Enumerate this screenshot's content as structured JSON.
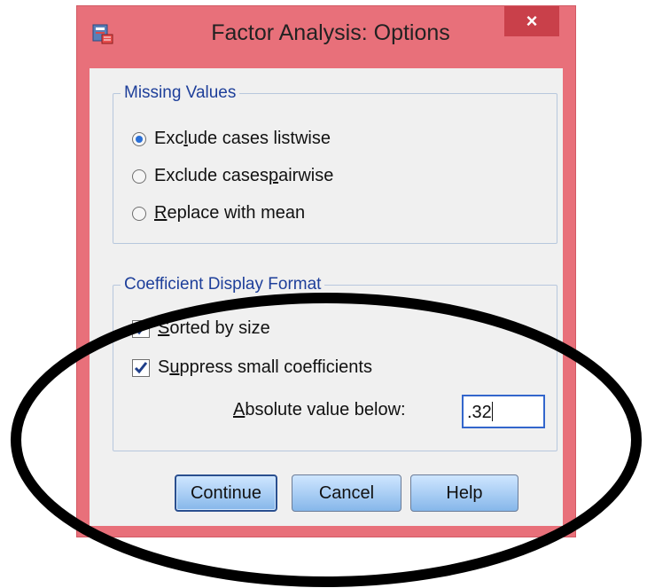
{
  "window": {
    "title": "Factor Analysis: Options",
    "close_glyph": "×"
  },
  "missing_values": {
    "legend": "Missing Values",
    "options": [
      {
        "label_pre": "Exc",
        "label_u": "l",
        "label_post": "ude cases listwise",
        "checked": true
      },
      {
        "label_pre": "Exclude cases ",
        "label_u": "p",
        "label_post": "airwise",
        "checked": false
      },
      {
        "label_pre": "",
        "label_u": "R",
        "label_post": "eplace with mean",
        "checked": false
      }
    ]
  },
  "coef_format": {
    "legend": "Coefficient Display Format",
    "sorted": {
      "label_pre": "",
      "label_u": "S",
      "label_post": "orted by size",
      "checked": true
    },
    "suppress": {
      "label_pre": "S",
      "label_u": "u",
      "label_post": "ppress small coefficients",
      "checked": true
    },
    "abs_label_pre": "",
    "abs_label_u": "A",
    "abs_label_post": "bsolute value below:",
    "abs_value": ".32"
  },
  "buttons": {
    "continue": "Continue",
    "cancel": "Cancel",
    "help": "Help"
  },
  "colors": {
    "frame": "#e8707a",
    "accent": "#2a6fd6",
    "legend_text": "#1e3f9a"
  },
  "icons": [
    "app-icon",
    "close-icon",
    "checkmark-icon"
  ]
}
